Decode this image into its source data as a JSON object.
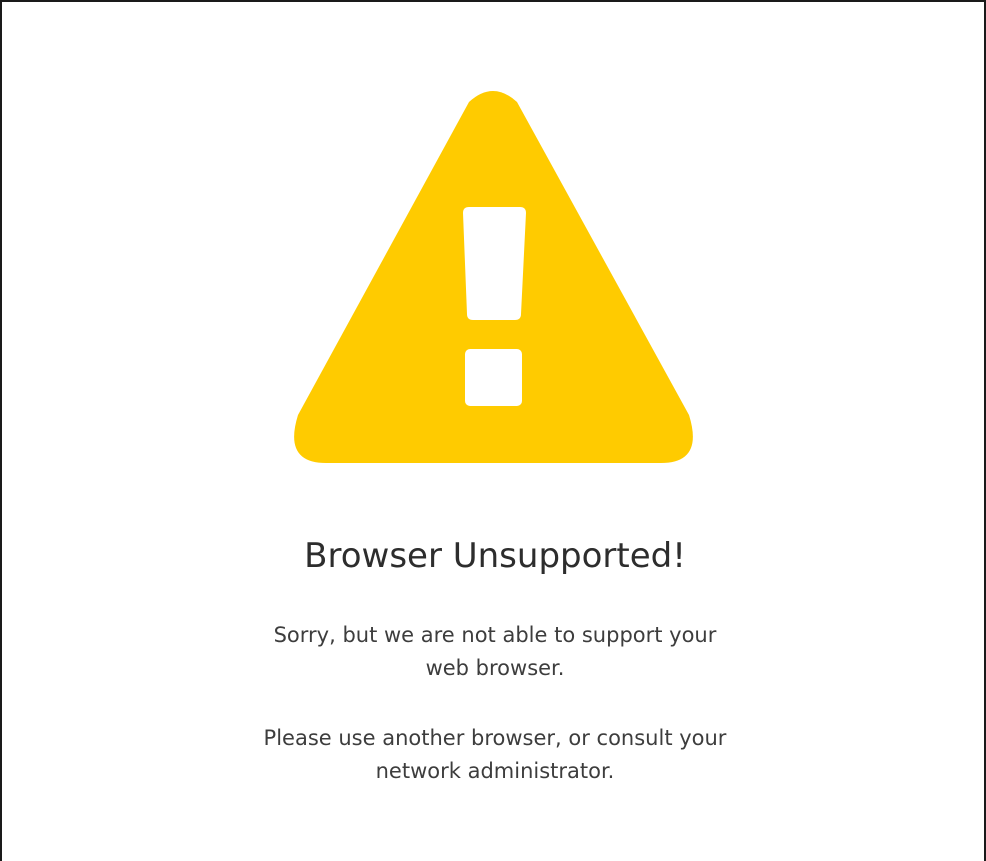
{
  "page": {
    "icon": "warning-triangle-icon",
    "icon_color": "#FFCB00",
    "title": "Browser Unsupported!",
    "message_1": {
      "line_1": "Sorry, but we are not able to support your",
      "line_2": "web browser."
    },
    "message_2": {
      "line_1": "Please use another browser, or consult your",
      "line_2": "network administrator."
    }
  }
}
